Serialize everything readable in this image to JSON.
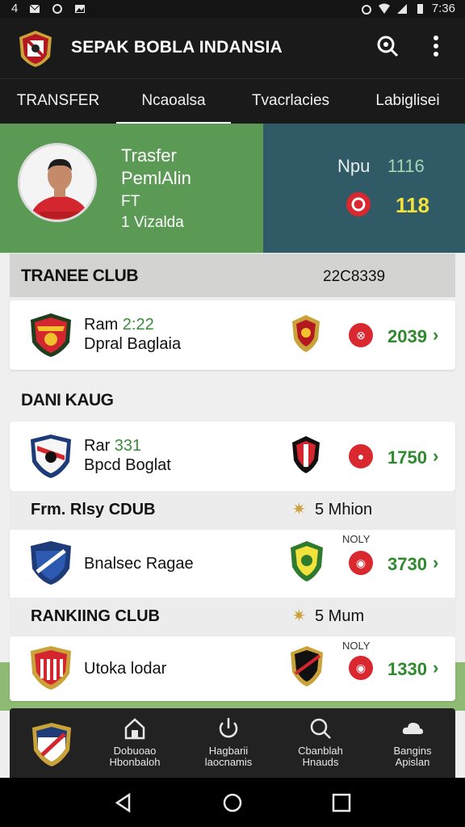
{
  "status_bar": {
    "left_text": "4",
    "time": "7:36"
  },
  "app": {
    "title": "SEPAK BOBLA INDANSIA"
  },
  "tabs": [
    {
      "label": "TRANSFER"
    },
    {
      "label": "Ncaoalsa"
    },
    {
      "label": "Tvacrlacies"
    },
    {
      "label": "Labiglisei"
    }
  ],
  "hero": {
    "title_line1": "Trasfer",
    "title_line2": "PemlAlin",
    "sub_line1": "FT",
    "sub_line2": "1 Vizalda",
    "stat_label": "Npu",
    "stat_value1": "1116",
    "stat_value2": "118"
  },
  "section1": {
    "title": "TRANEE CLUB",
    "value": "22C8339"
  },
  "row1": {
    "name": "Ram",
    "score": "2:22",
    "subtitle": "Dpral Baglaia",
    "value": "2039"
  },
  "section2": {
    "title": "DANI KAUG"
  },
  "row2": {
    "name": "Rar",
    "score": "331",
    "subtitle": "Bpcd Boglat",
    "value": "1750"
  },
  "strip1": {
    "label": "Frm. Rlsy CDUB",
    "right": "5 Mhion"
  },
  "row3": {
    "name": "Bnalsec Ragae",
    "tag": "NOLY",
    "value": "3730"
  },
  "strip2": {
    "label": "RANKIING CLUB",
    "right": "5 Mum"
  },
  "row4": {
    "name": "Utoka lodar",
    "tag": "NOLY",
    "value": "1330"
  },
  "bottom_nav": [
    {
      "line1": "Dobuoao",
      "line2": "Hbonbaloh",
      "icon": "home-icon"
    },
    {
      "line1": "Hagbarii",
      "line2": "laocnamis",
      "icon": "power-icon"
    },
    {
      "line1": "Cbanblah",
      "line2": "Hnauds",
      "icon": "search-icon"
    },
    {
      "line1": "Bangins",
      "line2": "Apislan",
      "icon": "cloud-icon"
    }
  ],
  "colors": {
    "hero_green": "#5a9a55",
    "hero_teal": "#2f5a66",
    "value_green": "#2f8a2f",
    "badge_red": "#d9282f",
    "accent_yellow": "#f1e23c"
  }
}
